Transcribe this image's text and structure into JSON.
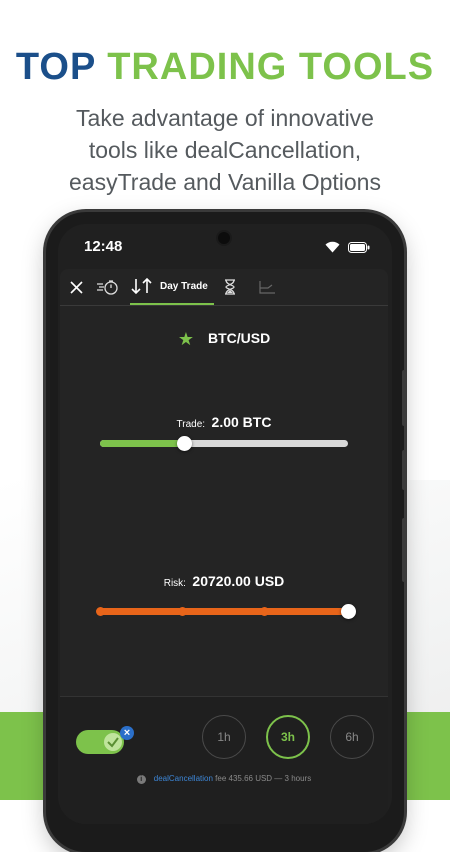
{
  "headline": {
    "part1": "TOP",
    "part2": "TRADING TOOLS"
  },
  "subtitle": {
    "line1": "Take advantage of innovative",
    "line2": "tools like dealCancellation,",
    "line3": "easyTrade and Vanilla Options"
  },
  "status": {
    "time": "12:48"
  },
  "toolbar": {
    "close_icon": "close-icon",
    "tabs": [
      {
        "icon": "timer-icon"
      },
      {
        "icon": "up-down-arrows-icon",
        "label": "Day Trade"
      },
      {
        "icon": "hourglass-icon"
      },
      {
        "icon": "chart-icon"
      }
    ]
  },
  "pair": {
    "name": "BTC/USD"
  },
  "trade": {
    "label": "Trade:",
    "value": "2.00 BTC",
    "level": 0.34
  },
  "risk": {
    "label": "Risk:",
    "value": "20720.00 USD",
    "level": 1.0,
    "stops": [
      0,
      0.33,
      0.66,
      1.0
    ]
  },
  "durations": [
    "1h",
    "3h",
    "6h"
  ],
  "selected_duration": "3h",
  "deal": {
    "prefix": "deal",
    "name": "Cancellation",
    "text": " fee 435.66 USD — 3 hours"
  },
  "colors": {
    "blue": "#1b4f8a",
    "green": "#7dc24b",
    "orange": "#e8651a"
  }
}
